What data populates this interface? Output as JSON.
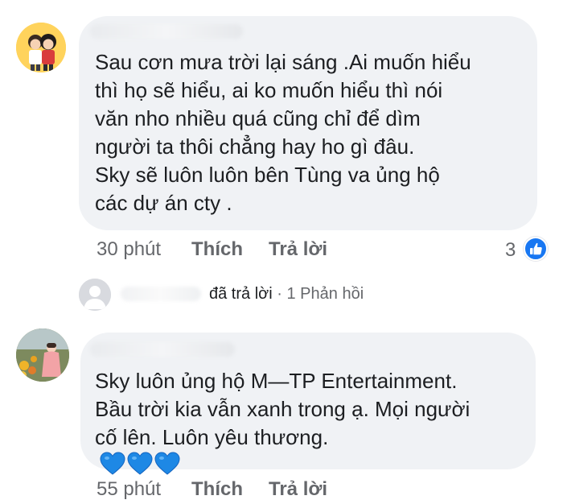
{
  "comment1": {
    "lines": [
      "Sau cơn mưa trời lại sáng .Ai muốn hiểu",
      "thì họ sẽ hiểu, ai ko muốn hiểu thì nói",
      "văn nho nhiều quá cũng chỉ để dìm",
      "người ta thôi chẳng hay ho gì đâu.",
      "Sky sẽ luôn luôn bên Tùng va ủng hộ",
      "các dự án cty ."
    ],
    "time": "30 phút",
    "like_label": "Thích",
    "reply_label": "Trả lời",
    "reaction_count": "3",
    "reaction_icon": "like-thumb-icon"
  },
  "reply_summary": {
    "verb": "đã trả lời",
    "separator": "·",
    "count_text": "1 Phản hồi"
  },
  "comment2": {
    "lines": [
      "Sky luôn ủng hộ M—TP Entertainment.",
      "Bầu trời kia vẫn xanh trong ạ. Mọi người",
      "cố lên. Luôn yêu thương."
    ],
    "emoji": [
      "blue-heart-icon",
      "blue-heart-icon",
      "blue-heart-icon"
    ],
    "time": "55 phút",
    "like_label": "Thích",
    "reply_label": "Trả lời"
  },
  "colors": {
    "bubble": "#f0f2f5",
    "meta_text": "#65676b",
    "like_blue": "#1877f2",
    "heart_blue": "#1e88e5"
  }
}
